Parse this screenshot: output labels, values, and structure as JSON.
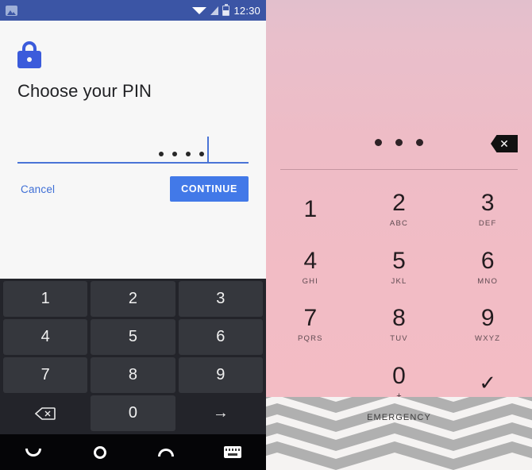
{
  "left_phone": {
    "status_bar": {
      "notification_icon": "image-notification-icon",
      "wifi_icon": "wifi-icon",
      "signal_icon": "signal-icon",
      "battery_icon": "battery-icon",
      "time": "12:30",
      "background_color": "#3b55a5"
    },
    "setup_screen": {
      "lock_icon": "lock-icon",
      "title": "Choose your PIN",
      "pin_entry": {
        "masked_dots": 4,
        "caret_visible": true,
        "underline_color": "#4a74d6"
      },
      "cancel_label": "Cancel",
      "continue_label": "CONTINUE",
      "continue_color": "#4279e8",
      "cancel_color": "#3f6fd6"
    },
    "keyboard": {
      "background": "#23242a",
      "key_color": "#35373d",
      "rows": [
        [
          "1",
          "2",
          "3"
        ],
        [
          "4",
          "5",
          "6"
        ],
        [
          "7",
          "8",
          "9"
        ]
      ],
      "bottom_row": {
        "backspace_icon": "backspace-icon",
        "zero": "0",
        "enter_icon": "arrow-right-icon"
      }
    },
    "nav_bar": {
      "back_icon": "back-icon",
      "home_icon": "home-icon",
      "recents_icon": "recents-icon",
      "keyboard_icon": "keyboard-switch-icon",
      "background": "#050507"
    }
  },
  "right_phone": {
    "lockscreen": {
      "background_color": "#f0bcc6",
      "entered_dots": 3,
      "backspace_icon": "backspace-icon",
      "emergency_label": "EMERGENCY",
      "wallpaper": "gray-white-chevron-pattern"
    },
    "keypad": [
      {
        "number": "1",
        "letters": ""
      },
      {
        "number": "2",
        "letters": "ABC"
      },
      {
        "number": "3",
        "letters": "DEF"
      },
      {
        "number": "4",
        "letters": "GHI"
      },
      {
        "number": "5",
        "letters": "JKL"
      },
      {
        "number": "6",
        "letters": "MNO"
      },
      {
        "number": "7",
        "letters": "PQRS"
      },
      {
        "number": "8",
        "letters": "TUV"
      },
      {
        "number": "9",
        "letters": "WXYZ"
      },
      {
        "number": "0",
        "letters": "+"
      }
    ],
    "confirm_icon": "check-icon",
    "confirm_glyph": "✓"
  }
}
